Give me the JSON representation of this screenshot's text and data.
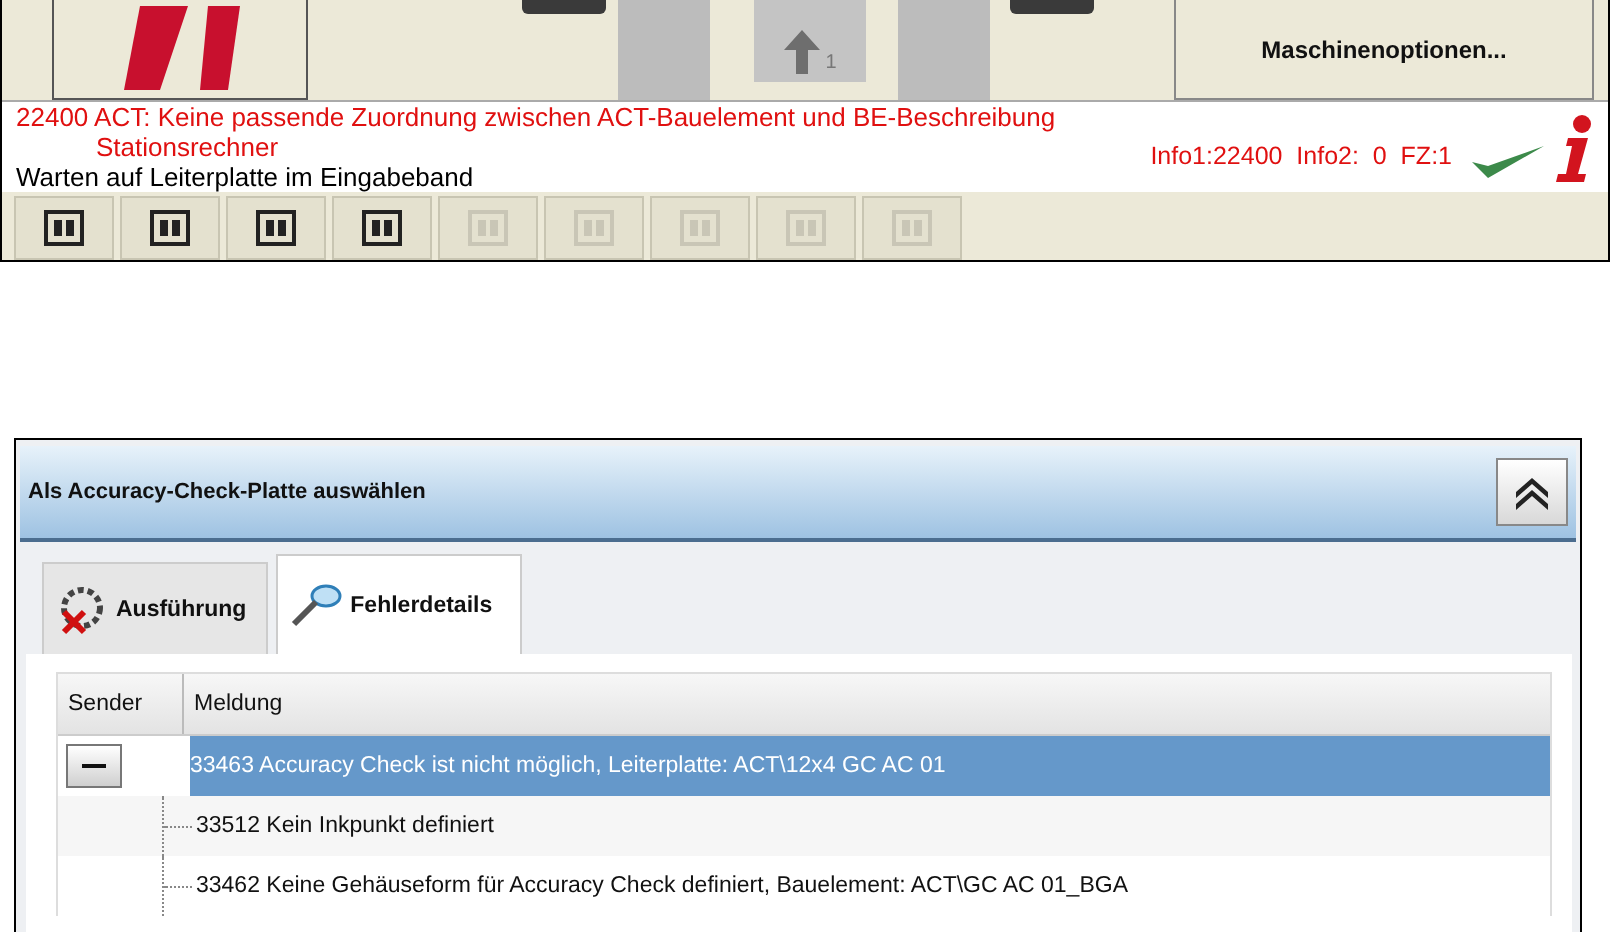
{
  "machine_panel": {
    "tool_buttons": [
      {
        "kind": "big"
      },
      {
        "kind": "tab"
      },
      {
        "kind": "block"
      },
      {
        "kind": "arrow",
        "label": "1"
      },
      {
        "kind": "block"
      },
      {
        "kind": "tab"
      },
      {
        "kind": "text",
        "label": "Maschinenoptionen..."
      }
    ],
    "status": {
      "error_line": "22400 ACT: Keine passende Zuordnung zwischen ACT-Bauelement und BE-Beschreibung",
      "source": "Stationsrechner",
      "info": "Info1:22400  Info2:  0  FZ:1",
      "message": "Warten auf Leiterplatte im Eingabeband"
    },
    "toolbar": [
      {
        "disabled": false
      },
      {
        "disabled": false
      },
      {
        "disabled": false
      },
      {
        "disabled": false
      },
      {
        "disabled": true
      },
      {
        "disabled": true
      },
      {
        "disabled": true
      },
      {
        "disabled": true
      },
      {
        "disabled": true
      }
    ]
  },
  "dialog": {
    "title": "Als Accuracy-Check-Platte auswählen",
    "tabs": [
      {
        "label": "Ausführung",
        "selected": false
      },
      {
        "label": "Fehlerdetails",
        "selected": true
      }
    ],
    "table": {
      "columns": [
        "Sender",
        "Meldung"
      ],
      "rows": [
        {
          "text": "33463 Accuracy Check ist nicht möglich, Leiterplatte: ACT\\12x4 GC AC 01",
          "selected": true,
          "expanded": true,
          "children": [
            {
              "text": "33512 Kein Inkpunkt definiert",
              "selected": false
            },
            {
              "text": "33462 Keine Gehäuseform für Accuracy Check definiert, Bauelement: ACT\\GC AC 01_BGA",
              "selected": false
            }
          ]
        }
      ]
    }
  }
}
